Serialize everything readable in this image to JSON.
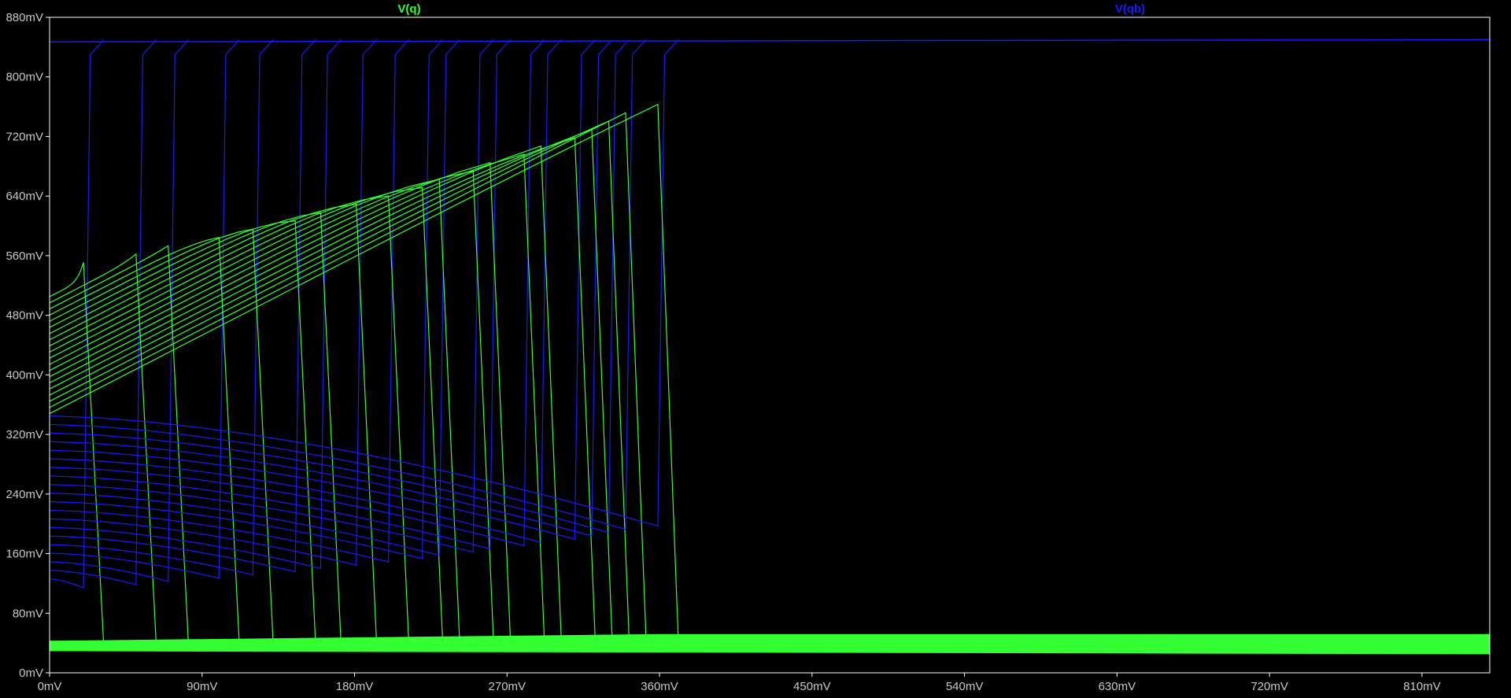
{
  "chart_data": {
    "type": "line",
    "title": "",
    "xlabel": "",
    "ylabel": "",
    "xlim": [
      0,
      850
    ],
    "ylim": [
      0,
      880
    ],
    "x_ticks": [
      0,
      90,
      180,
      270,
      360,
      450,
      540,
      630,
      720,
      810
    ],
    "x_tick_labels": [
      "0mV",
      "90mV",
      "180mV",
      "270mV",
      "360mV",
      "450mV",
      "540mV",
      "630mV",
      "720mV",
      "810mV"
    ],
    "y_ticks": [
      0,
      80,
      160,
      240,
      320,
      400,
      480,
      560,
      640,
      720,
      800,
      880
    ],
    "y_tick_labels": [
      "0mV",
      "80mV",
      "160mV",
      "240mV",
      "320mV",
      "400mV",
      "480mV",
      "560mV",
      "640mV",
      "720mV",
      "800mV",
      "880mV"
    ],
    "grid": false,
    "legend_position": "top",
    "background_color": "#000000",
    "frame_color": "#ffffff",
    "series": [
      {
        "name": "V(q)",
        "color": "#33ff33",
        "sweep_count": 20,
        "switch_points_x": [
          20,
          51,
          70,
          100,
          120,
          145,
          160,
          181,
          200,
          220,
          230,
          250,
          260,
          280,
          290,
          310,
          320,
          330,
          340,
          359
        ],
        "start_y_range": [
          505,
          348
        ],
        "peak_y_range": [
          551,
          763
        ],
        "slope_mV_per_mV": 1.17,
        "low_level_y_range": [
          35,
          49
        ],
        "low_band_y": [
          25,
          52
        ]
      },
      {
        "name": "V(qb)",
        "color": "#1a1aff",
        "sweep_count": 20,
        "switch_points_x": [
          20,
          51,
          70,
          100,
          120,
          145,
          160,
          181,
          200,
          220,
          230,
          250,
          260,
          280,
          290,
          310,
          320,
          330,
          340,
          359
        ],
        "start_y_range": [
          126,
          345
        ],
        "end_y_range": [
          114,
          197
        ],
        "high_level_y": 850
      }
    ]
  }
}
